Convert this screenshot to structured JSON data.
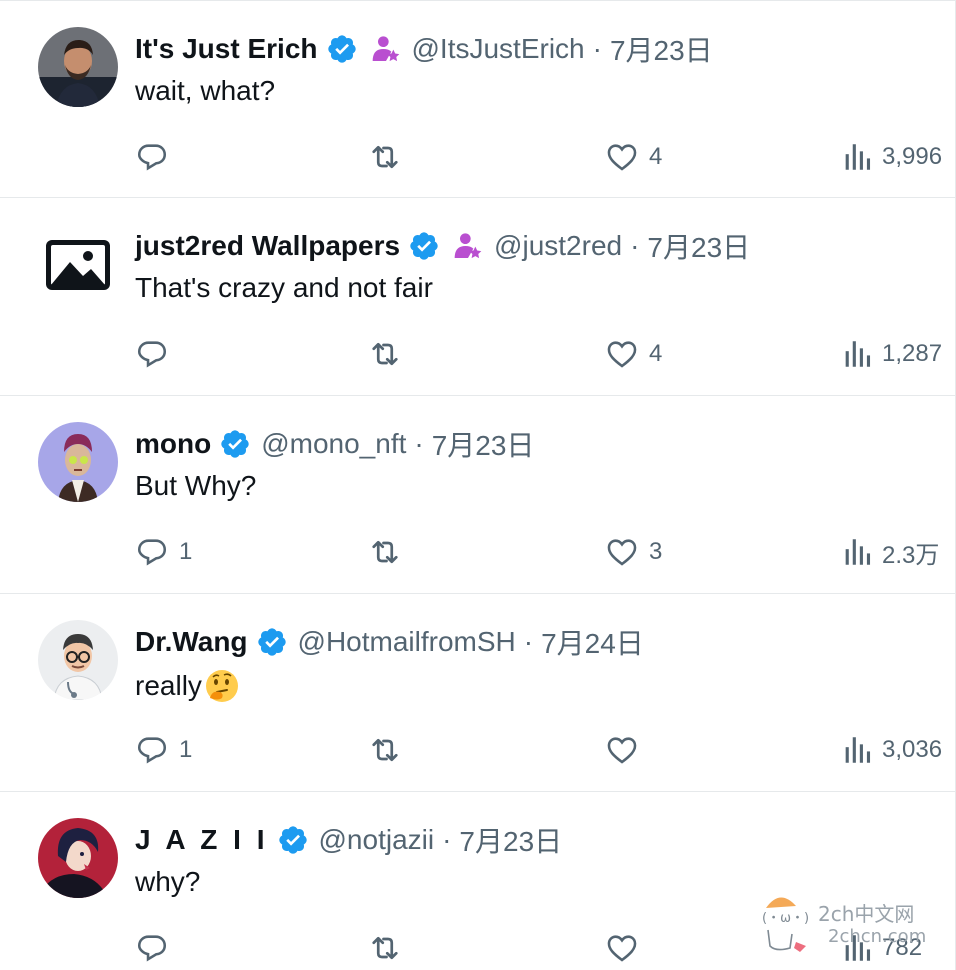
{
  "tweets": [
    {
      "name": "It's Just Erich",
      "handle": "@ItsJustErich",
      "separator": "·",
      "date": "7月23日",
      "text": "wait, what?",
      "reply_count": "",
      "retweet_count": "",
      "like_count": "4",
      "view_count": "3,996",
      "avatar_icon": "man-beard-avatar",
      "verified": true,
      "affiliate": true
    },
    {
      "name": "just2red Wallpapers",
      "handle": "@just2red",
      "separator": "·",
      "date": "7月23日",
      "text": "That's crazy and not fair",
      "reply_count": "",
      "retweet_count": "",
      "like_count": "4",
      "view_count": "1,287",
      "avatar_icon": "image-placeholder-icon",
      "verified": true,
      "affiliate": true
    },
    {
      "name": "mono",
      "handle": "@mono_nft",
      "separator": "·",
      "date": "7月23日",
      "text": "But Why?",
      "reply_count": "1",
      "retweet_count": "",
      "like_count": "3",
      "view_count": "2.3万",
      "avatar_icon": "nft-character-avatar",
      "verified": true,
      "affiliate": false
    },
    {
      "name": "Dr.Wang",
      "handle": "@HotmailfromSH",
      "separator": "·",
      "date": "7月24日",
      "text": "really",
      "text_emoji": "thinking-face-emoji",
      "reply_count": "1",
      "retweet_count": "",
      "like_count": "",
      "view_count": "3,036",
      "avatar_icon": "doctor-cartoon-avatar",
      "verified": true,
      "affiliate": false
    },
    {
      "name": "J A Z I I",
      "handle": "@notjazii",
      "separator": "·",
      "date": "7月23日",
      "text": "why?",
      "reply_count": "",
      "retweet_count": "",
      "like_count": "",
      "view_count": "782",
      "avatar_icon": "anime-character-avatar",
      "verified": true,
      "affiliate": false
    }
  ],
  "watermark": {
    "title": "2ch中文网",
    "url": "2chcn.com",
    "face": "(・ω・)"
  },
  "colors": {
    "verified_blue": "#1d9bf0",
    "affiliate_purple": "#b94fd0",
    "text_primary": "#0f1419",
    "text_secondary": "#536471",
    "divider": "#e6e9eb"
  }
}
